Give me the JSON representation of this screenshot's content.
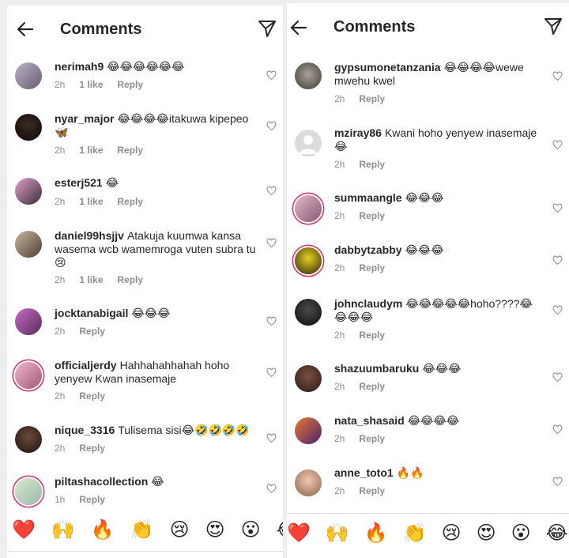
{
  "left": {
    "header": {
      "title": "Comments"
    },
    "comments": [
      {
        "user": "nerimah9",
        "text": "😂😂😂😂😂😂",
        "time": "2h",
        "likes": "1 like",
        "reply": "Reply"
      },
      {
        "user": "nyar_major",
        "text": "😂😂😂😂itakuwa kipepeo 🦋",
        "time": "2h",
        "likes": "1 like",
        "reply": "Reply"
      },
      {
        "user": "esterj521",
        "text": "😂",
        "time": "2h",
        "likes": "1 like",
        "reply": "Reply"
      },
      {
        "user": "daniel99hsjjv",
        "text": "Atakuja kuumwa kansa wasema wcb wamemroga vuten subra tu😢",
        "time": "2h",
        "likes": "1 like",
        "reply": "Reply"
      },
      {
        "user": "jocktanabigail",
        "text": "😂😂😂",
        "time": "2h",
        "likes": "",
        "reply": "Reply"
      },
      {
        "user": "officialjerdy",
        "text": "Hahhahahhahah hoho yenyew Kwan inasemaje",
        "time": "2h",
        "likes": "",
        "reply": "Reply"
      },
      {
        "user": "nique_3316",
        "text": "Tulisema sisi😂🤣🤣🤣🤣",
        "time": "2h",
        "likes": "",
        "reply": "Reply"
      },
      {
        "user": "piltashacollection",
        "text": "😂",
        "time": "1h",
        "likes": "",
        "reply": "Reply"
      }
    ],
    "emojis": [
      "❤️",
      "🙌",
      "🔥",
      "👏",
      "😢",
      "😍",
      "😮",
      "😂"
    ]
  },
  "right": {
    "header": {
      "title": "Comments"
    },
    "comments": [
      {
        "user": "gypsumonetanzania",
        "text": "😂😂😂😂wewe mwehu kwel",
        "time": "2h",
        "reply": "Reply"
      },
      {
        "user": "mziray86",
        "text": "Kwani hoho yenyew inasemaje😂",
        "time": "2h",
        "reply": "Reply"
      },
      {
        "user": "summaangle",
        "text": "😂😂😂",
        "time": "2h",
        "reply": "Reply"
      },
      {
        "user": "dabbytzabby",
        "text": "😂😂😂",
        "time": "2h",
        "reply": "Reply"
      },
      {
        "user": "johnclaudym",
        "text": "😂😂😂😂😂hoho????😂😂😂😂",
        "time": "2h",
        "reply": "Reply"
      },
      {
        "user": "shazuumbaruku",
        "text": "😂😂😂",
        "time": "2h",
        "reply": "Reply"
      },
      {
        "user": "nata_shasaid",
        "text": "😂😂😂😂",
        "time": "2h",
        "reply": "Reply"
      },
      {
        "user": "anne_toto1",
        "text": "🔥🔥",
        "time": "2h",
        "reply": "Reply"
      }
    ],
    "emojis": [
      "❤️",
      "🙌",
      "🔥",
      "👏",
      "😢",
      "😍",
      "😮",
      "😂"
    ]
  },
  "colors": {
    "ring": "#d6306f",
    "meta": "#8e8e8e",
    "text": "#262626"
  }
}
